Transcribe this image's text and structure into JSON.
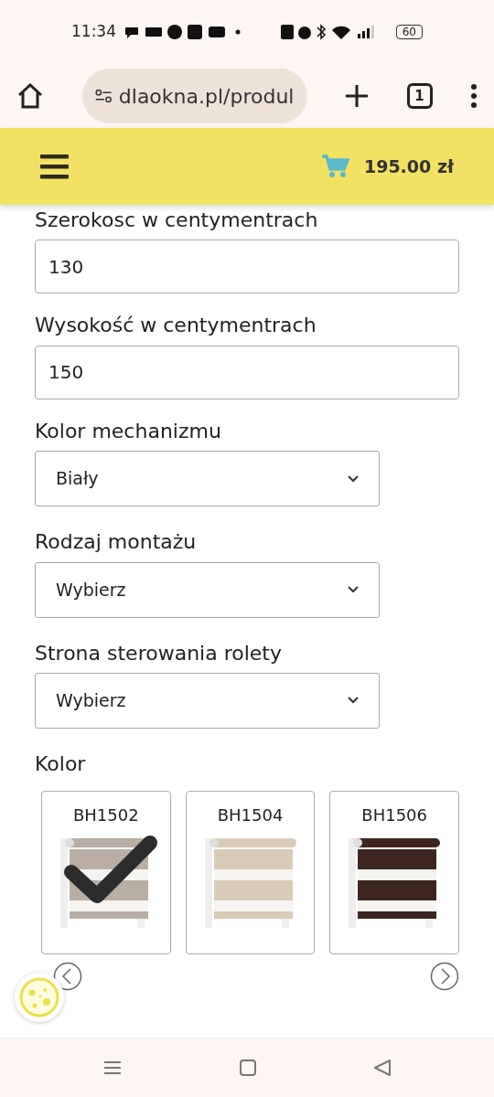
{
  "status_bar": {
    "time": "11:34",
    "battery": "60"
  },
  "browser": {
    "url": "dlaokna.pl/produl",
    "tab_count": "1"
  },
  "header": {
    "cart_total": "195.00 zł"
  },
  "form": {
    "partial_label": "Szerokosc w centymentrach",
    "fields": [
      {
        "kind": "input",
        "value": "130"
      },
      {
        "kind": "input",
        "label": "Wysokość w centymentrach",
        "value": "150"
      },
      {
        "kind": "select",
        "label": "Kolor mechanizmu",
        "value": "Biały"
      },
      {
        "kind": "select",
        "label": "Rodzaj montażu",
        "value": "Wybierz"
      },
      {
        "kind": "select",
        "label": "Strona sterowania rolety",
        "value": "Wybierz"
      }
    ],
    "color_label": "Kolor",
    "swatches": [
      {
        "code": "BH1502",
        "selected": true,
        "color": "#b8aea4"
      },
      {
        "code": "BH1504",
        "selected": false,
        "color": "#d9cbb6"
      },
      {
        "code": "BH1506",
        "selected": false,
        "color": "#3d2620"
      }
    ]
  }
}
